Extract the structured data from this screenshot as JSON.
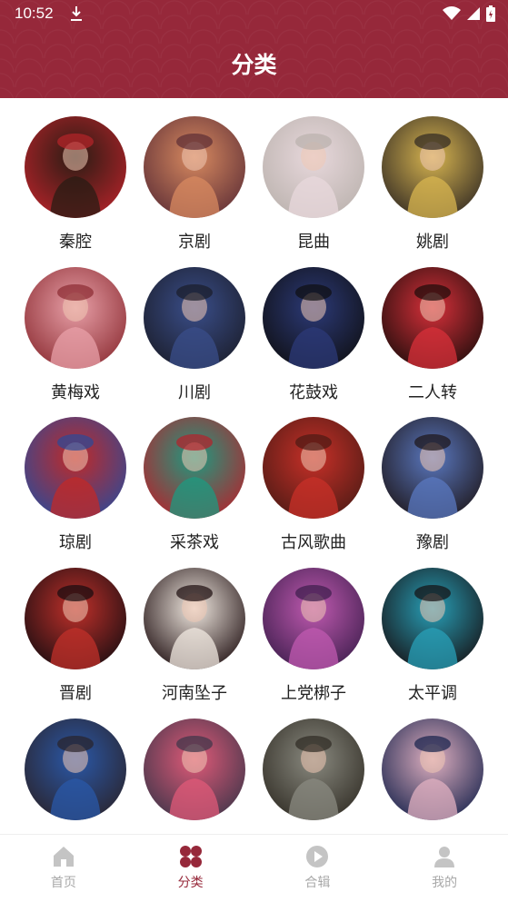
{
  "status_bar": {
    "time": "10:52"
  },
  "header": {
    "title": "分类"
  },
  "categories": [
    {
      "label": "秦腔",
      "theme": [
        "#b8232a",
        "#2a1c14"
      ]
    },
    {
      "label": "京剧",
      "theme": [
        "#5b2c35",
        "#d88a60"
      ]
    },
    {
      "label": "昆曲",
      "theme": [
        "#b9b1ac",
        "#e8d8dc"
      ]
    },
    {
      "label": "姚剧",
      "theme": [
        "#2d2622",
        "#d8b550"
      ]
    },
    {
      "label": "黄梅戏",
      "theme": [
        "#8a2a30",
        "#e8a0a8"
      ]
    },
    {
      "label": "川剧",
      "theme": [
        "#1a1c28",
        "#3a4e8a"
      ]
    },
    {
      "label": "花鼓戏",
      "theme": [
        "#0e0e10",
        "#2c3a78"
      ]
    },
    {
      "label": "二人转",
      "theme": [
        "#1a0c0a",
        "#d8303a"
      ]
    },
    {
      "label": "琼剧",
      "theme": [
        "#2a4a9a",
        "#c02a28"
      ]
    },
    {
      "label": "采茶戏",
      "theme": [
        "#b8202a",
        "#1e9a80"
      ]
    },
    {
      "label": "古风歌曲",
      "theme": [
        "#4a1a14",
        "#c83028"
      ]
    },
    {
      "label": "豫剧",
      "theme": [
        "#1c1416",
        "#5a78c0"
      ]
    },
    {
      "label": "晋剧",
      "theme": [
        "#140c10",
        "#c0302a"
      ]
    },
    {
      "label": "河南坠子",
      "theme": [
        "#1a0a0c",
        "#f0e8e0"
      ]
    },
    {
      "label": "上党梆子",
      "theme": [
        "#3a1c4a",
        "#c05ab0"
      ]
    },
    {
      "label": "太平调",
      "theme": [
        "#160e10",
        "#28a0b8"
      ]
    },
    {
      "label": "",
      "theme": [
        "#2a2228",
        "#2a58a8"
      ]
    },
    {
      "label": "",
      "theme": [
        "#3a3448",
        "#e05a78"
      ]
    },
    {
      "label": "",
      "theme": [
        "#2e2a22",
        "#8a8a80"
      ]
    },
    {
      "label": "",
      "theme": [
        "#14204a",
        "#e0b0c0"
      ]
    }
  ],
  "bottom_nav": [
    {
      "label": "首页",
      "icon": "home-icon",
      "active": false
    },
    {
      "label": "分类",
      "icon": "category-icon",
      "active": true
    },
    {
      "label": "合辑",
      "icon": "play-icon",
      "active": false
    },
    {
      "label": "我的",
      "icon": "user-icon",
      "active": false
    }
  ],
  "colors": {
    "brand": "#96283a",
    "inactive": "#a8a8a8"
  }
}
